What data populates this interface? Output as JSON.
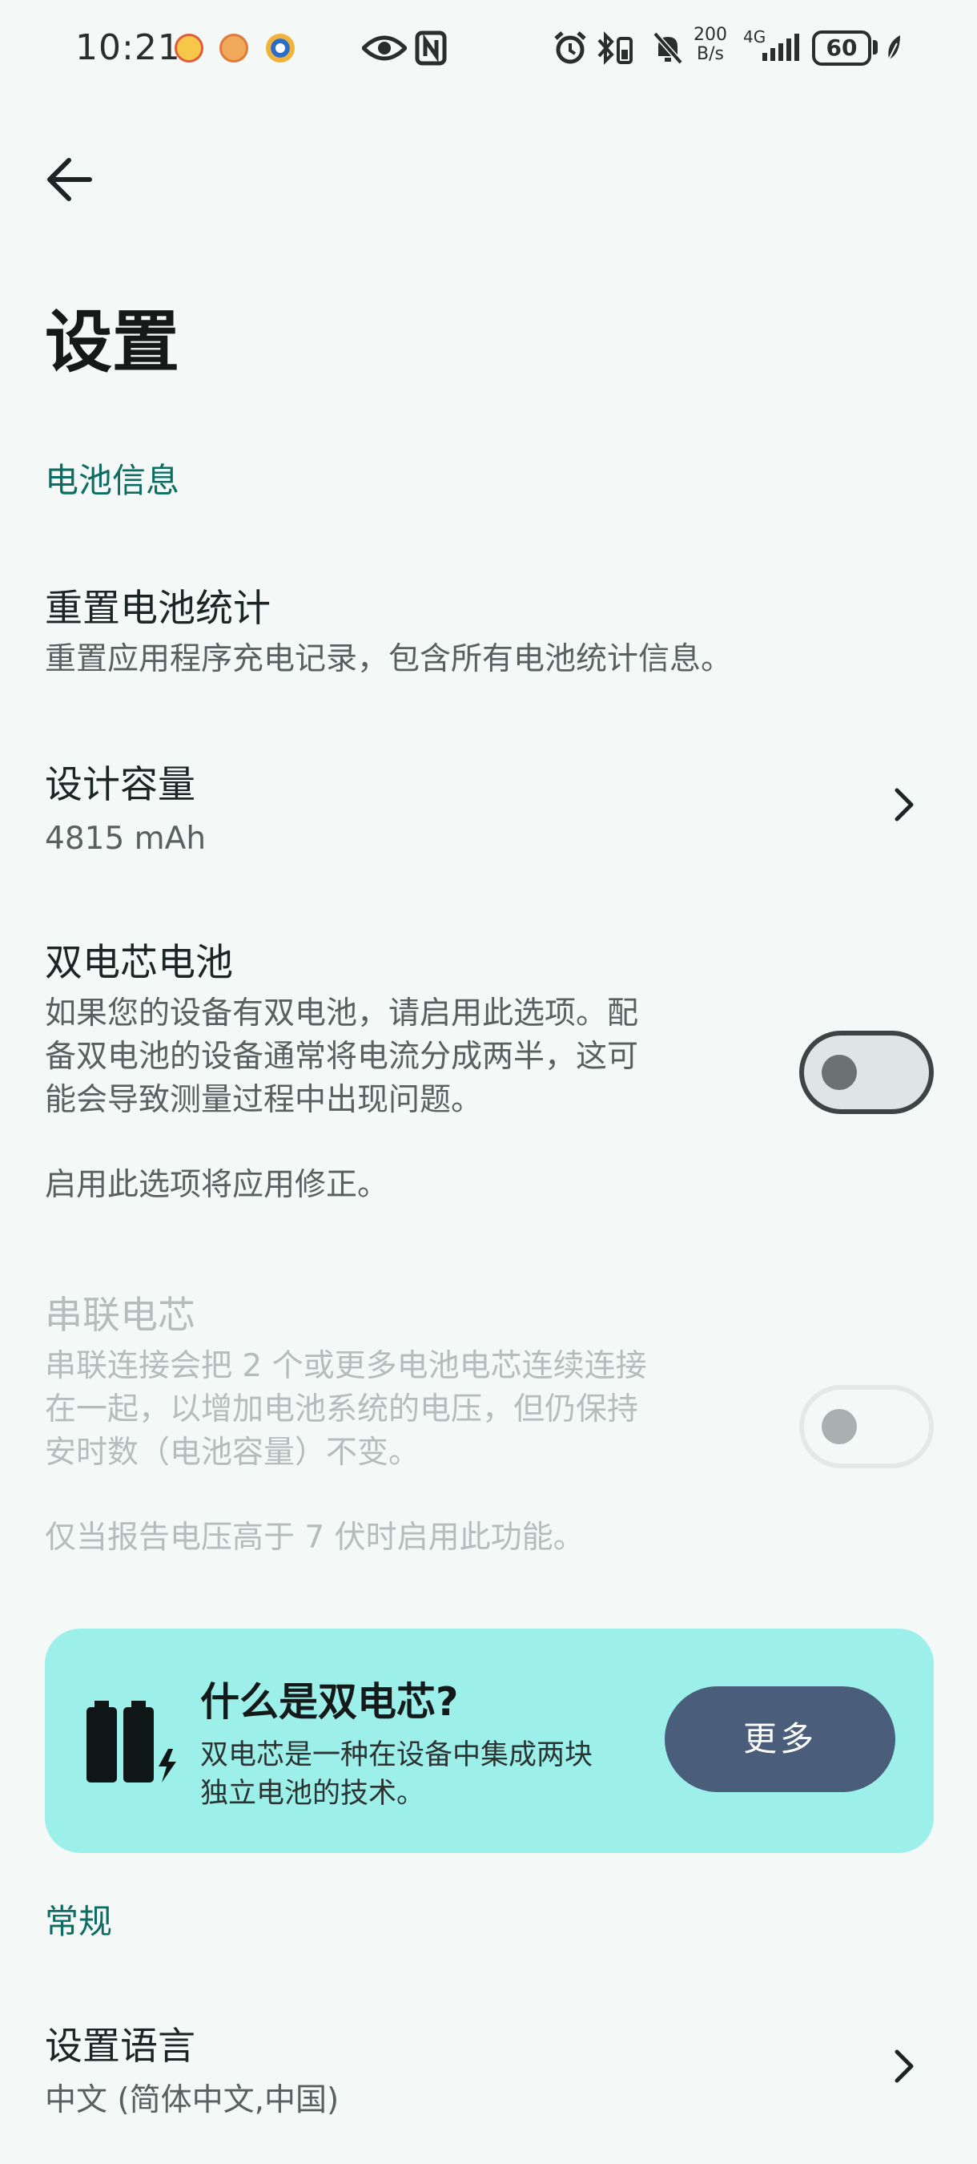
{
  "status_bar": {
    "time": "10:21",
    "net_speed_value": "200",
    "net_speed_unit": "B/s",
    "network_type": "4G",
    "battery_level": "60"
  },
  "page": {
    "title": "设置"
  },
  "sections": {
    "battery_info": "电池信息",
    "general": "常规"
  },
  "items": {
    "reset_stats": {
      "title": "重置电池统计",
      "desc": "重置应用程序充电记录，包含所有电池统计信息。"
    },
    "design_capacity": {
      "title": "设计容量",
      "value": "4815 mAh"
    },
    "dual_cell": {
      "title": "双电芯电池",
      "desc_line1": "如果您的设备有双电池，请启用此选项。配",
      "desc_line2": "备双电池的设备通常将电流分成两半，这可",
      "desc_line3": "能会导致测量过程中出现问题。",
      "note": "启用此选项将应用修正。",
      "enabled": false
    },
    "series_cell": {
      "title": "串联电芯",
      "desc_line1": "串联连接会把 2 个或更多电池电芯连续连接",
      "desc_line2": "在一起，以增加电池系统的电压，但仍保持",
      "desc_line3": "安时数（电池容量）不变。",
      "note": "仅当报告电压高于 7 伏时启用此功能。",
      "enabled": false
    },
    "language": {
      "title": "设置语言",
      "value": "中文 (简体中文,中国)"
    }
  },
  "info_card": {
    "title": "什么是双电芯?",
    "desc_line1": "双电芯是一种在设备中集成两块",
    "desc_line2": "独立电池的技术。",
    "button": "更多",
    "icon": "dual-battery-icon"
  },
  "colors": {
    "accent": "#0c6d63",
    "card_bg": "#9df0e9",
    "button_bg": "#4a5e7b",
    "background": "#f4f8f7"
  }
}
